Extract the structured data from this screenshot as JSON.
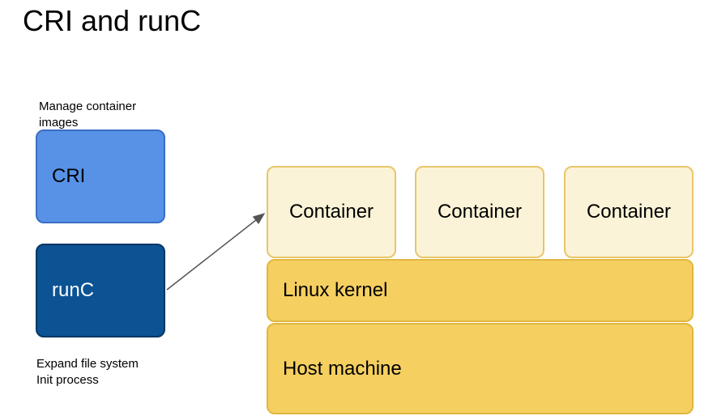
{
  "title": "CRI and runC",
  "captions": {
    "top": "Manage container\nimages",
    "bottom": "Expand file system\nInit process"
  },
  "boxes": {
    "cri": {
      "label": "CRI"
    },
    "runc": {
      "label": "runC"
    },
    "containers": [
      {
        "label": "Container"
      },
      {
        "label": "Container"
      },
      {
        "label": "Container"
      }
    ],
    "kernel": {
      "label": "Linux kernel"
    },
    "host": {
      "label": "Host machine"
    }
  },
  "colors": {
    "cri_bg": "#5792e7",
    "cri_border": "#3b6dc5",
    "runc_bg": "#0c5394",
    "runc_border": "#073763",
    "container_bg": "#fbf3d7",
    "container_border": "#e8c66a",
    "layer_bg": "#f5cf60",
    "layer_border": "#e0b73f"
  }
}
